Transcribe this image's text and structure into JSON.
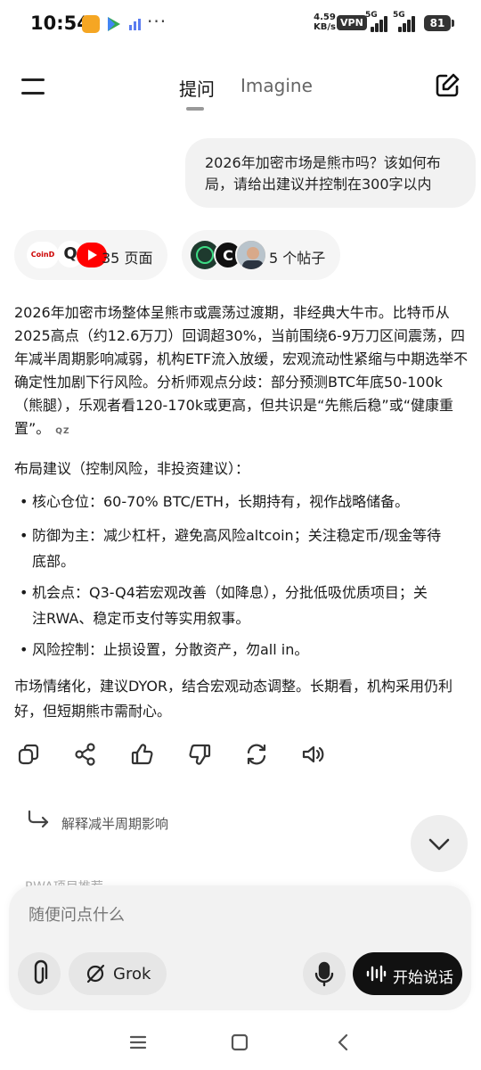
{
  "status_bar": {
    "time": "10:54",
    "speed_value": "4.59",
    "speed_unit": "KB/s",
    "vpn": "VPN",
    "sim1": "5G",
    "sim2": "5G",
    "battery": "81"
  },
  "header": {
    "tabs": [
      {
        "label": "提问",
        "active": true
      },
      {
        "label": "Imagine",
        "active": false
      }
    ]
  },
  "user_message": "2026年加密市场是熊市吗？该如何布局，请给出建议并控制在300字以内",
  "sources": {
    "pages_label": "35 页面",
    "posts_label": "5 个帖子",
    "logo_text": "CoinD",
    "logo_letter": "Q",
    "avatar_letter": "C"
  },
  "answer": {
    "intro": "2026年加密市场整体呈熊市或震荡过渡期，非经典大牛市。比特币从2025高点（约12.6万刀）回调超30%，当前围绕6-9万刀区间震荡，四年减半周期影响减弱，机构ETF流入放缓，宏观流动性紧缩与中期选举不确定性加剧下行风险。分析师观点分歧：部分预测BTC年底50-100k（熊腿），乐观者看120-170k或更高，但共识是“先熊后稳”或“健康重置”。",
    "intro_cite": "QZ",
    "strategy_title": "布局建议（控制风险，非投资建议）：",
    "bullets": [
      {
        "line1": "核心仓位：60-70% BTC/ETH，长期持有，视作战略储备。",
        "line2": ""
      },
      {
        "line1": "防御为主：减少杠杆，避免高风险altcoin；关注稳定币/现金等待",
        "line2": "底部。"
      },
      {
        "line1": "机会点：Q3-Q4若宏观改善（如降息），分批低吸优质项目；关",
        "line2": "注RWA、稳定币支付等实用叙事。"
      },
      {
        "line1": "风险控制：止损设置，分散资产，勿all in。",
        "line2": ""
      }
    ],
    "closing": "市场情绪化，建议DYOR，结合宏观动态调整。长期看，机构采用仍利好，但短期熊市需耐心。"
  },
  "followups": [
    {
      "label": "解释减半周期影响"
    },
    {
      "label": "RWA项目推荐"
    }
  ],
  "composer": {
    "placeholder": "随便问点什么",
    "model_label": "Grok",
    "speak_label": "开始说话"
  }
}
